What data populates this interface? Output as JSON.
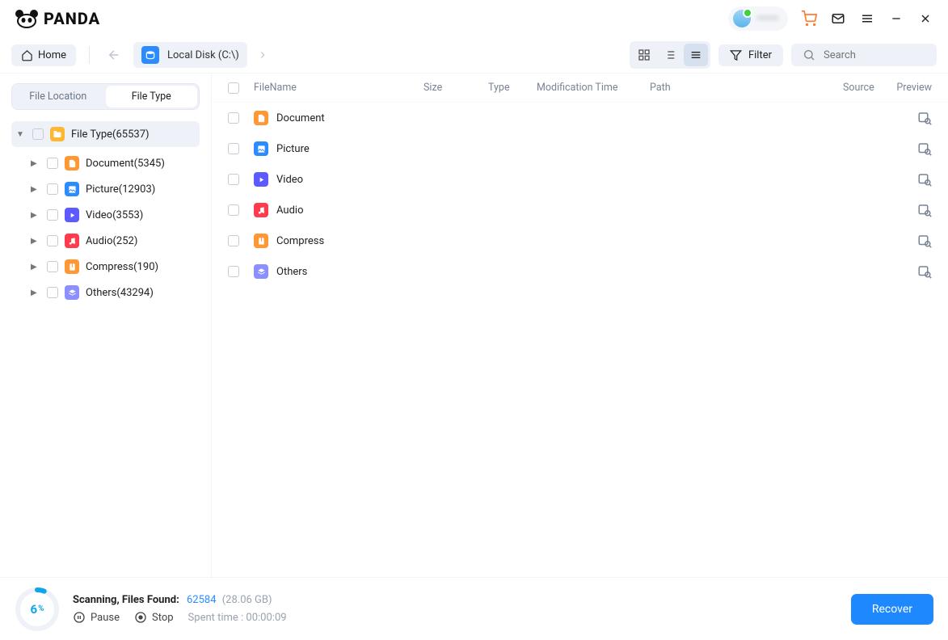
{
  "app": {
    "name": "PANDA"
  },
  "titlebar": {
    "user_blurred": "••••••"
  },
  "toolbar": {
    "home": "Home",
    "disk": "Local Disk (C:\\)",
    "filter": "Filter",
    "search_placeholder": "Search"
  },
  "sidebar": {
    "tabs": {
      "location": "File Location",
      "type": "File Type"
    },
    "root": "File Type(65537)",
    "nodes": [
      {
        "label": "Document(5345)",
        "ico": "ico-doc"
      },
      {
        "label": "Picture(12903)",
        "ico": "ico-pic"
      },
      {
        "label": "Video(3553)",
        "ico": "ico-vid"
      },
      {
        "label": "Audio(252)",
        "ico": "ico-aud"
      },
      {
        "label": "Compress(190)",
        "ico": "ico-comp"
      },
      {
        "label": "Others(43294)",
        "ico": "ico-oth"
      }
    ]
  },
  "columns": {
    "name": "FileName",
    "size": "Size",
    "type": "Type",
    "mtime": "Modification Time",
    "path": "Path",
    "source": "Source",
    "preview": "Preview"
  },
  "rows": [
    {
      "label": "Document",
      "ico": "ico-doc"
    },
    {
      "label": "Picture",
      "ico": "ico-pic"
    },
    {
      "label": "Video",
      "ico": "ico-vid"
    },
    {
      "label": "Audio",
      "ico": "ico-aud"
    },
    {
      "label": "Compress",
      "ico": "ico-comp"
    },
    {
      "label": "Others",
      "ico": "ico-oth"
    }
  ],
  "footer": {
    "percent": "6",
    "percent_unit": "%",
    "status": "Scanning, Files Found:",
    "found": "62584",
    "bytes": "(28.06 GB)",
    "pause": "Pause",
    "stop": "Stop",
    "spent": "Spent time : 00:00:09",
    "recover": "Recover"
  }
}
